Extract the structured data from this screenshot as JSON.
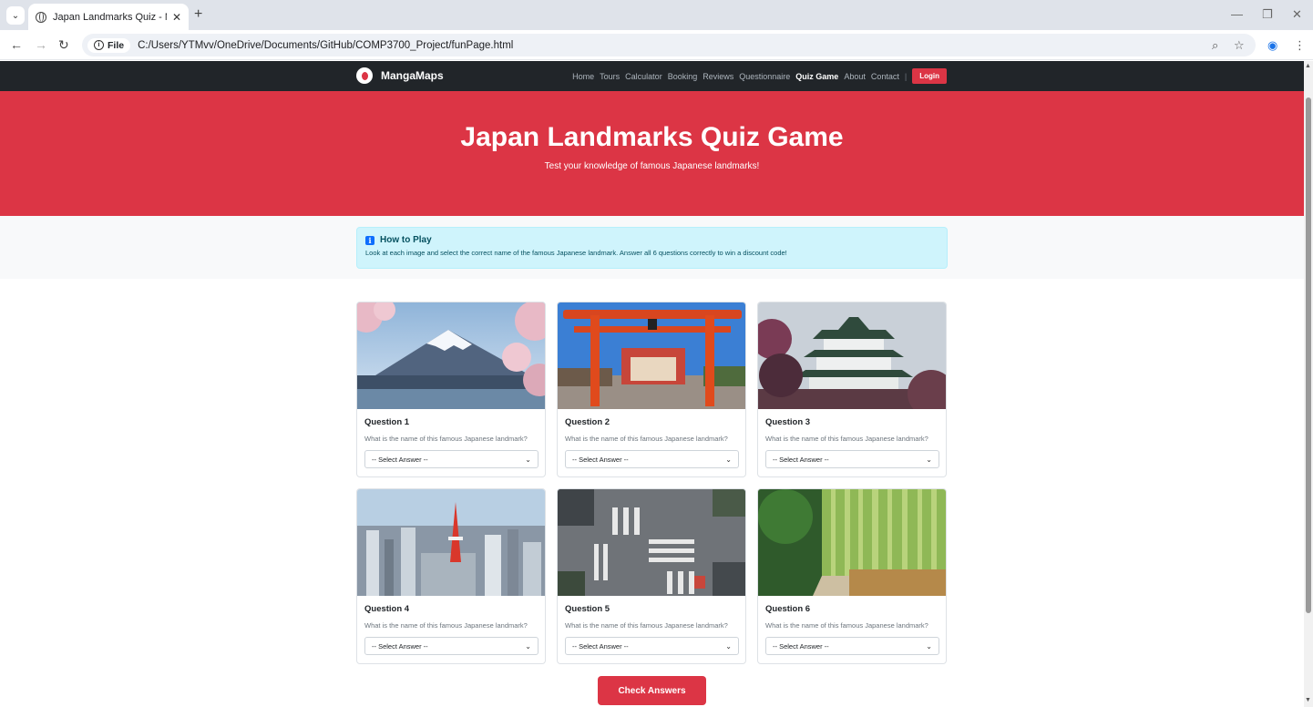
{
  "browser": {
    "tab_title": "Japan Landmarks Quiz - Manga",
    "file_label": "File",
    "url": "C:/Users/YTMvv/OneDrive/Documents/GitHub/COMP3700_Project/funPage.html"
  },
  "navbar": {
    "brand": "MangaMaps",
    "links": [
      "Home",
      "Tours",
      "Calculator",
      "Booking",
      "Reviews",
      "Questionnaire",
      "Quiz Game",
      "About",
      "Contact"
    ],
    "active": "Quiz Game",
    "separator": "|",
    "login": "Login"
  },
  "hero": {
    "title": "Japan Landmarks Quiz Game",
    "subtitle": "Test your knowledge of famous Japanese landmarks!"
  },
  "howto": {
    "title": "How to Play",
    "text": "Look at each image and select the correct name of the famous Japanese landmark. Answer all 6 questions correctly to win a discount code!"
  },
  "questions": [
    {
      "title": "Question 1",
      "prompt": "What is the name of this famous Japanese landmark?",
      "selected": "-- Select Answer --"
    },
    {
      "title": "Question 2",
      "prompt": "What is the name of this famous Japanese landmark?",
      "selected": "-- Select Answer --"
    },
    {
      "title": "Question 3",
      "prompt": "What is the name of this famous Japanese landmark?",
      "selected": "-- Select Answer --"
    },
    {
      "title": "Question 4",
      "prompt": "What is the name of this famous Japanese landmark?",
      "selected": "-- Select Answer --"
    },
    {
      "title": "Question 5",
      "prompt": "What is the name of this famous Japanese landmark?",
      "selected": "-- Select Answer --"
    },
    {
      "title": "Question 6",
      "prompt": "What is the name of this famous Japanese landmark?",
      "selected": "-- Select Answer --"
    }
  ],
  "check_button": "Check Answers",
  "colors": {
    "accent": "#dc3545",
    "navbar": "#212529",
    "alert_bg": "#cff4fc",
    "alert_text": "#055160"
  }
}
